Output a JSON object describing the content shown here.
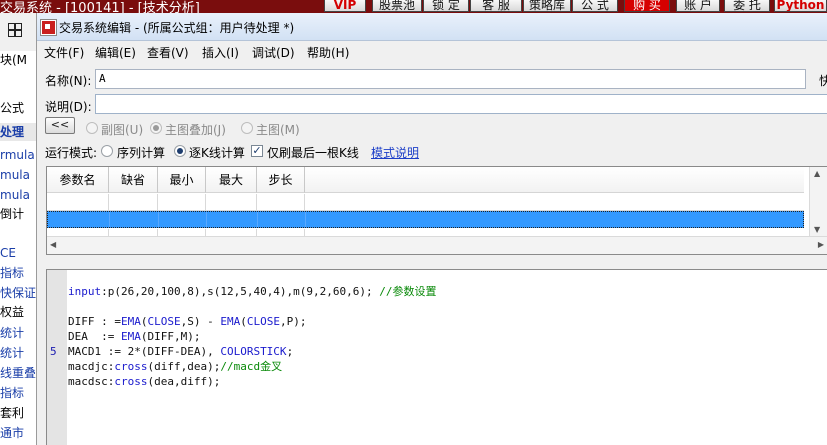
{
  "bg": {
    "title": "交易系统 - [100141] - [技术分析]",
    "top_buttons": [
      "VIP",
      "股票池",
      "锁 定",
      "客 服",
      "策略库",
      "公 式",
      "购 买",
      "账 户",
      "委 托",
      "Python"
    ],
    "left_items": [
      "块(M",
      "公式",
      "处理",
      "rmula",
      "mula",
      "mula",
      "倒计",
      "CE",
      "指标",
      "快保证",
      "权益",
      "统计",
      "统计",
      "线重叠",
      "指标",
      "套利",
      "通市"
    ],
    "right_label": "快"
  },
  "dialog": {
    "title": "交易系统编辑 - (所属公式组：用户待处理 *)",
    "menu": [
      "文件(F)",
      "编辑(E)",
      "查看(V)",
      "插入(I)",
      "调试(D)",
      "帮助(H)"
    ],
    "name_label": "名称(N):",
    "name_value": "A",
    "desc_label": "说明(D):",
    "desc_value": "",
    "collapse_label": "<<",
    "chart_options": [
      "副图(U)",
      "主图叠加(J)",
      "主图(M)"
    ],
    "run_mode_label": "运行模式:",
    "run_options": [
      "序列计算",
      "逐K线计算"
    ],
    "only_last_label": "仅刷最后一根K线",
    "mode_link": "模式说明",
    "param_headers": [
      "参数名",
      "缺省",
      "最小",
      "最大",
      "步长"
    ]
  },
  "editor": {
    "gutter_marks": [
      "5"
    ],
    "lines": [
      "input:p(26,20,100,8),s(12,5,40,4),m(9,2,60,6); //参数设置",
      "",
      "DIFF : =EMA(CLOSE,S) - EMA(CLOSE,P);",
      "DEA  := EMA(DIFF,M);",
      "MACD1 := 2*(DIFF-DEA), COLORSTICK;",
      "macdjc:cross(diff,dea);//macd金叉",
      "macdsc:cross(dea,diff);"
    ]
  }
}
